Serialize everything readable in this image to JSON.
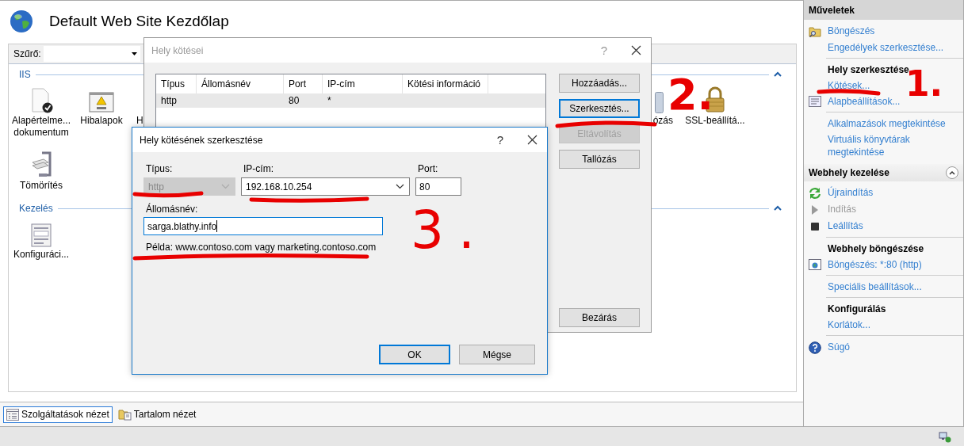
{
  "window": {
    "title": "Default Web Site Kezdőlap"
  },
  "filter": {
    "label": "Szűrő:"
  },
  "groups": [
    {
      "title": "IIS",
      "expanded": true,
      "rows": [
        {
          "left": [
            {
              "label": "Alapértelme... dokumentum",
              "kind": "document"
            },
            {
              "label": "Hibalapok",
              "kind": "error-page"
            },
            {
              "label": "H",
              "kind": "none"
            }
          ],
          "right": [
            {
              "label": "ózás",
              "kind": "generic"
            },
            {
              "label": "SSL-beállítá...",
              "kind": "lock"
            }
          ]
        },
        {
          "left": [
            {
              "label": "Tömörítés",
              "kind": "compression"
            }
          ]
        }
      ]
    },
    {
      "title": "Kezelés",
      "expanded": true,
      "rows": [
        {
          "left": [
            {
              "label": "Konfiguráci...",
              "kind": "config"
            }
          ]
        }
      ]
    }
  ],
  "view_tabs": [
    {
      "label": "Szolgáltatások nézet",
      "selected": true,
      "kind": "features"
    },
    {
      "label": "Tartalom nézet",
      "selected": false,
      "kind": "content"
    }
  ],
  "actions": {
    "title": "Műveletek",
    "sections": [
      {
        "items": [
          {
            "label": "Böngészés",
            "kind": "folder-search",
            "disabled": false
          },
          {
            "label": "Engedélyek szerkesztése...",
            "disabled": false
          }
        ]
      },
      {
        "heading": "Hely szerkesztése",
        "items": [
          {
            "label": "Kötések...",
            "disabled": false
          },
          {
            "label": "Alapbeállítások...",
            "kind": "settings-list",
            "disabled": false
          }
        ]
      },
      {
        "items": [
          {
            "label": "Alkalmazások megtekintése",
            "disabled": false
          },
          {
            "label": "Virtuális könyvtárak megtekintése",
            "disabled": false
          }
        ]
      }
    ]
  },
  "site": {
    "title": "Webhely kezelése",
    "expanded": true,
    "sections": [
      {
        "items": [
          {
            "label": "Újraindítás",
            "kind": "restart",
            "disabled": false
          },
          {
            "label": "Indítás",
            "kind": "start",
            "disabled": true
          },
          {
            "label": "Leállítás",
            "kind": "stop",
            "disabled": false
          }
        ]
      },
      {
        "heading": "Webhely böngészése",
        "items": [
          {
            "label": "Böngészés: *:80 (http)",
            "kind": "browse",
            "disabled": false
          }
        ]
      },
      {
        "items": [
          {
            "label": "Speciális beállítások...",
            "disabled": false
          }
        ]
      },
      {
        "heading": "Konfigurálás",
        "items": [
          {
            "label": "Korlátok...",
            "disabled": false
          }
        ]
      },
      {
        "items": [
          {
            "label": "Súgó",
            "kind": "help",
            "disabled": false
          }
        ]
      }
    ]
  },
  "bindings_dialog": {
    "title": "Hely kötései",
    "active": false,
    "help": "?",
    "columns": [
      "Típus",
      "Állomásnév",
      "Port",
      "IP-cím",
      "Kötési információ"
    ],
    "rows": [
      {
        "type": "http",
        "port": "80",
        "ip": "*",
        "selected": true
      }
    ],
    "buttons": [
      {
        "label": "Hozzáadás...",
        "disabled": false,
        "focused": false
      },
      {
        "label": "Szerkesztés...",
        "disabled": false,
        "focused": true
      },
      {
        "label": "Eltávolítás",
        "disabled": true,
        "focused": false
      },
      {
        "label": "Tallózás",
        "disabled": false,
        "focused": false
      }
    ],
    "close_button": "Bezárás"
  },
  "edit_dialog": {
    "title": "Hely kötésének szerkesztése",
    "active": true,
    "help": "?",
    "type": {
      "label": "Típus:",
      "value": "http",
      "disabled": true
    },
    "ip": {
      "label": "IP-cím:",
      "value": "192.168.10.254"
    },
    "port": {
      "label": "Port:",
      "value": "80"
    },
    "host": {
      "label": "Állomásnév:",
      "value": "sarga.blathy.info",
      "focused": true
    },
    "example": "Példa: www.contoso.com vagy marketing.contoso.com",
    "buttons": [
      {
        "label": "OK",
        "default": true
      },
      {
        "label": "Mégse",
        "default": false
      }
    ]
  },
  "annotations": [
    {
      "label": "1."
    },
    {
      "label": "2."
    },
    {
      "label": "3."
    }
  ]
}
